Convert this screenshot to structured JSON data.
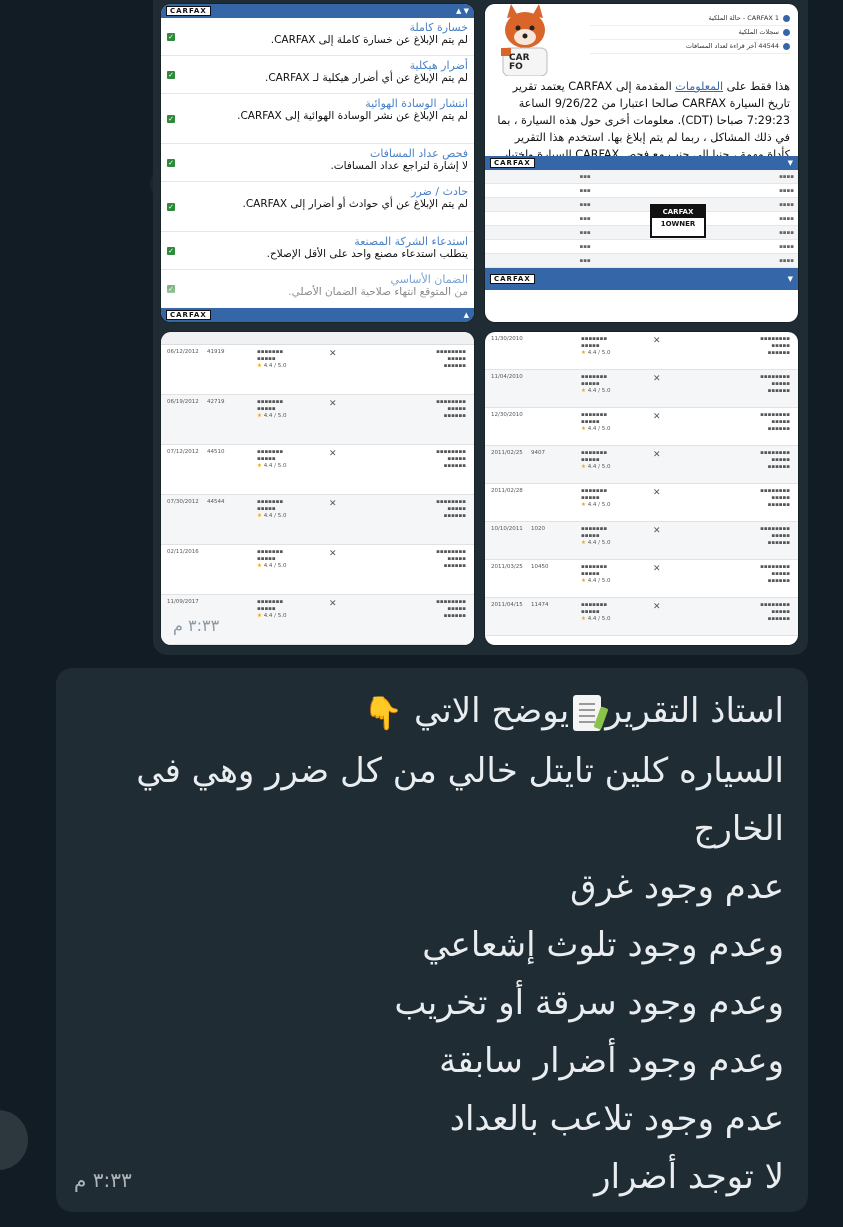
{
  "album": {
    "time": "٣:٣٣ م",
    "tile1": {
      "header": "CARFAX",
      "rows": [
        {
          "head": "خسارة كاملة",
          "desc": "لم يتم الإبلاغ عن خسارة كاملة إلى CARFAX."
        },
        {
          "head": "أضرار هيكلية",
          "desc": "لم يتم الإبلاغ عن أي أضرار هيكلية لـ CARFAX."
        },
        {
          "head": "انتشار الوسادة الهوائية",
          "desc": "لم يتم الإبلاغ عن نشر الوسادة الهوائية إلى CARFAX."
        },
        {
          "head": "فحص عداد المسافات",
          "desc": "لا إشارة لتراجع عداد المسافات."
        },
        {
          "head": "حادث / ضرر",
          "desc": "لم يتم الإبلاغ عن أي حوادث أو أضرار إلى CARFAX."
        },
        {
          "head": "استدعاء الشركة المصنعة",
          "desc": "يتطلب استدعاء مصنع واحد على الأقل الإصلاح."
        },
        {
          "head": "الضمان الأساسي",
          "desc": "من المتوقع انتهاء صلاحية الضمان الأصلي."
        }
      ]
    },
    "tile2": {
      "top_rows": [
        "CARFAX 1 - حالة الملكية",
        "سجلات الملكية",
        "44544 آخر قراءة لعداد المسافات"
      ],
      "paragraph_pre": "هذا فقط على ",
      "paragraph_link": "المعلومات",
      "paragraph_post": " المقدمة إلى CARFAX يعتمد تقرير تاريخ السيارة CARFAX صالحا اعتبارا من 9/26/22 الساعة 7:29:23 صباحا (CDT). معلومات أخرى حول هذه السيارة ، بما في ذلك المشاكل ، ربما لم يتم إبلاغ بها. استخدم هذا التقرير كأداة مهمة ، جنبا إلى جنب مع فحص CARFAX السيارة واختبار القيادة ، لاتخاذ قرار أفضل بشأن سيارتك المستعملة التالية.",
      "fox_badge": "CAR FO",
      "owner_badge": [
        "CARFAX",
        "1OWNER"
      ]
    },
    "tile3": {
      "records": [
        {
          "date": "06/12/2012",
          "odo": "41919"
        },
        {
          "date": "06/19/2012",
          "odo": "42719"
        },
        {
          "date": "07/12/2012",
          "odo": "44510"
        },
        {
          "date": "07/30/2012",
          "odo": "44544"
        },
        {
          "date": "02/11/2016",
          "odo": ""
        },
        {
          "date": "11/09/2017",
          "odo": ""
        }
      ],
      "rating": "4.4 / 5.0",
      "time": "٣:٣٣ م"
    },
    "tile4": {
      "records": [
        {
          "date": "11/30/2010",
          "odo": ""
        },
        {
          "date": "11/04/2010",
          "odo": ""
        },
        {
          "date": "12/30/2010",
          "odo": ""
        },
        {
          "date": "2011/02/25",
          "odo": "9407"
        },
        {
          "date": "2011/02/28",
          "odo": ""
        },
        {
          "date": "10/10/2011",
          "odo": "1020"
        },
        {
          "date": "2011/03/25",
          "odo": "10450"
        },
        {
          "date": "2011/04/15",
          "odo": "11474"
        }
      ],
      "rating": "4.4 / 5.0"
    }
  },
  "message": {
    "lines": [
      "السياره كلين تايتل خالي من كل ضرر وهي في الخارج",
      "عدم وجود غرق",
      "وعدم وجود تلوث إشعاعي",
      "وعدم وجود سرقة أو تخريب",
      "وعدم وجود أضرار سابقة",
      "عدم وجود تلاعب بالعداد",
      "لا توجد أضرار"
    ],
    "first_line_a": "استاذ التقرير",
    "first_line_b": "يوضح الاتي",
    "time": "٣:٣٣ م"
  }
}
